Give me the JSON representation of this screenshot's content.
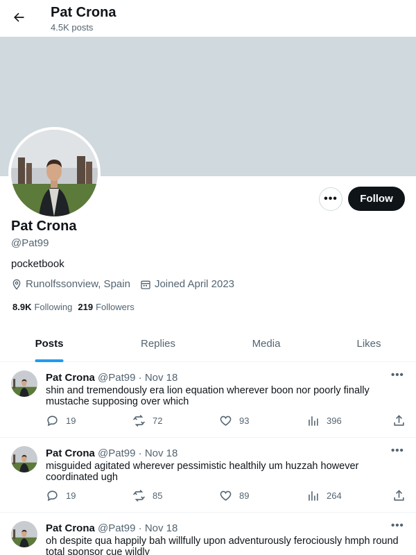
{
  "header": {
    "name": "Pat Crona",
    "posts_count": "4.5K posts"
  },
  "profile": {
    "display_name": "Pat Crona",
    "handle": "@Pat99",
    "bio": "pocketbook",
    "location": "Runolfssonview, Spain",
    "joined": "Joined April 2023",
    "following_count": "8.9K",
    "following_label": "Following",
    "followers_count": "219",
    "followers_label": "Followers",
    "follow_label": "Follow",
    "more_label": "•••"
  },
  "banner_color": "#cfd9de",
  "accent_color": "#1d9bf0",
  "tabs": [
    {
      "label": "Posts",
      "active": true
    },
    {
      "label": "Replies",
      "active": false
    },
    {
      "label": "Media",
      "active": false
    },
    {
      "label": "Likes",
      "active": false
    }
  ],
  "posts": [
    {
      "author": "Pat Crona",
      "handle": "@Pat99",
      "dot": "·",
      "date": "Nov 18",
      "more": "•••",
      "text": "shin and tremendously era lion equation wherever boon nor poorly finally mustache supposing over which",
      "replies": "19",
      "reposts": "72",
      "likes": "93",
      "views": "396"
    },
    {
      "author": "Pat Crona",
      "handle": "@Pat99",
      "dot": "·",
      "date": "Nov 18",
      "more": "•••",
      "text": "misguided agitated wherever pessimistic healthily um huzzah however coordinated ugh",
      "replies": "19",
      "reposts": "85",
      "likes": "89",
      "views": "264"
    },
    {
      "author": "Pat Crona",
      "handle": "@Pat99",
      "dot": "·",
      "date": "Nov 18",
      "more": "•••",
      "text": "oh despite qua happily bah willfully upon adventurously ferociously hmph round total sponsor cue wildly",
      "replies": "",
      "reposts": "",
      "likes": "",
      "views": ""
    }
  ]
}
